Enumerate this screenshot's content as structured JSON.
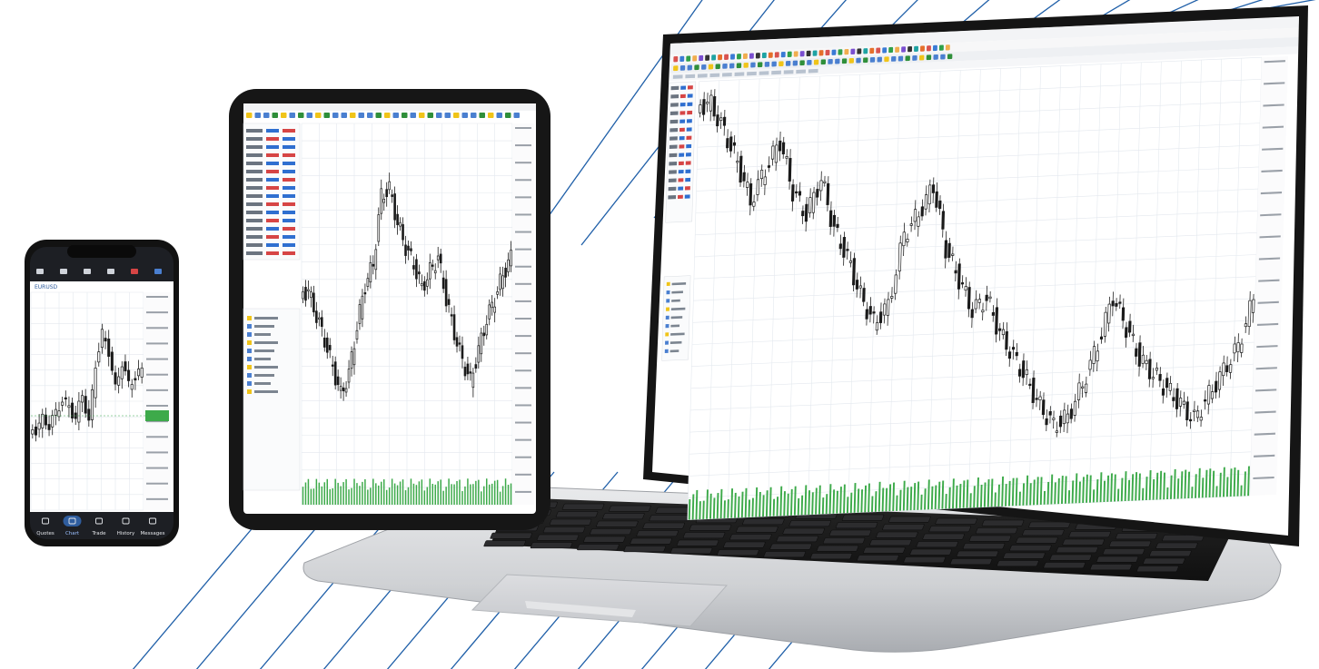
{
  "colors": {
    "accent_lines": "#1f5fa8",
    "candle": "#1a1a1a",
    "volume": "#3daa4a",
    "grid": "#e3e8ee",
    "phone_bar": "#1d1f24",
    "phone_active_tab": "#2f5d9e"
  },
  "phone": {
    "symbol_label": "EURUSD",
    "tabs": [
      "Quotes",
      "Chart",
      "Trade",
      "History",
      "Messages"
    ],
    "active_tab_index": 1,
    "icons": [
      "menu-icon",
      "crosshair-icon",
      "indicator-icon",
      "timeframe-icon",
      "symbols-icon",
      "trade-icon"
    ],
    "tab_icons": [
      "quotes-icon",
      "chart-icon",
      "trade-icon",
      "history-icon",
      "messages-icon"
    ],
    "closes": [
      0.63,
      0.58,
      0.61,
      0.55,
      0.49,
      0.52,
      0.58,
      0.46,
      0.6,
      0.32,
      0.18,
      0.26,
      0.44,
      0.31,
      0.42,
      0.38,
      0.35
    ]
  },
  "tablet": {
    "closes": [
      0.48,
      0.55,
      0.62,
      0.7,
      0.78,
      0.72,
      0.58,
      0.46,
      0.4,
      0.2,
      0.18,
      0.28,
      0.35,
      0.4,
      0.47,
      0.42,
      0.38,
      0.5,
      0.6,
      0.68,
      0.74,
      0.65,
      0.56,
      0.5,
      0.43,
      0.38
    ]
  },
  "laptop": {
    "closes": [
      0.05,
      0.12,
      0.2,
      0.3,
      0.22,
      0.15,
      0.28,
      0.34,
      0.25,
      0.38,
      0.45,
      0.55,
      0.62,
      0.58,
      0.4,
      0.35,
      0.28,
      0.44,
      0.52,
      0.6,
      0.57,
      0.66,
      0.72,
      0.78,
      0.85,
      0.9,
      0.88,
      0.8,
      0.7,
      0.58,
      0.66,
      0.74,
      0.78,
      0.82,
      0.86,
      0.9,
      0.84,
      0.78,
      0.72,
      0.6
    ]
  }
}
